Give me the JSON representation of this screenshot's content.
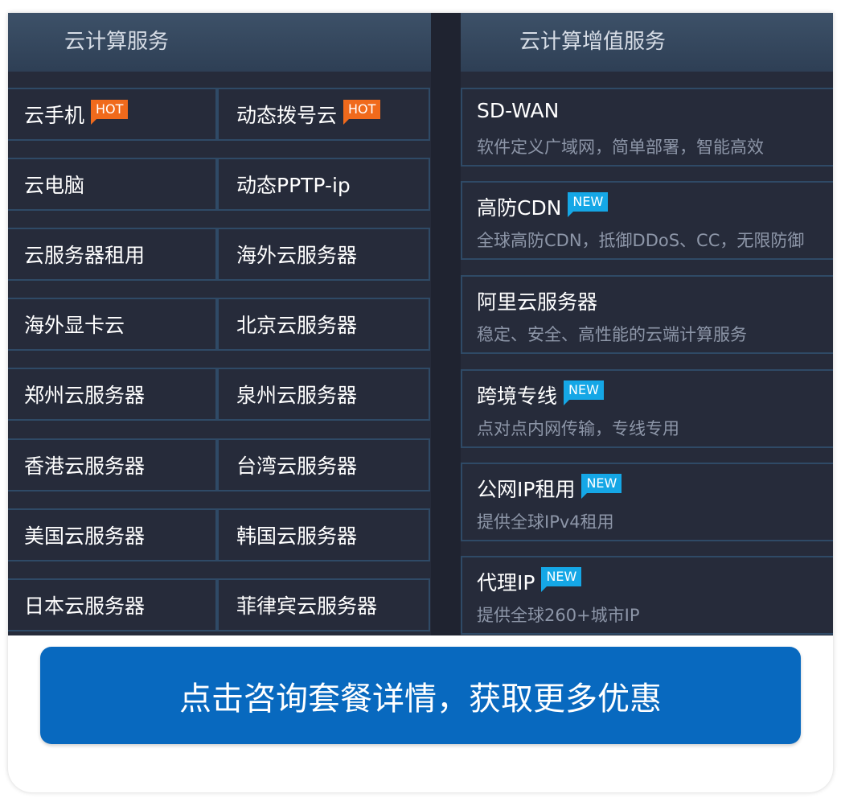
{
  "left_header": "云计算服务",
  "right_header": "云计算增值服务",
  "left_grid": [
    [
      {
        "label": "云手机",
        "tag": "HOT"
      },
      {
        "label": "动态拨号云",
        "tag": "HOT"
      }
    ],
    [
      {
        "label": "云电脑"
      },
      {
        "label": "动态PPTP-ip"
      }
    ],
    [
      {
        "label": "云服务器租用"
      },
      {
        "label": "海外云服务器"
      }
    ],
    [
      {
        "label": "海外显卡云"
      },
      {
        "label": "北京云服务器"
      }
    ],
    [
      {
        "label": "郑州云服务器"
      },
      {
        "label": "泉州云服务器"
      }
    ],
    [
      {
        "label": "香港云服务器"
      },
      {
        "label": "台湾云服务器"
      }
    ],
    [
      {
        "label": "美国云服务器"
      },
      {
        "label": "韩国云服务器"
      }
    ],
    [
      {
        "label": "日本云服务器"
      },
      {
        "label": "菲律宾云服务器"
      }
    ]
  ],
  "services": [
    {
      "name": "SD-WAN",
      "desc": "软件定义广域网，简单部署，智能高效"
    },
    {
      "name": "高防CDN",
      "tag": "NEW",
      "desc": "全球高防CDN，抵御DDoS、CC，无限防御"
    },
    {
      "name": "阿里云服务器",
      "desc": "稳定、安全、高性能的云端计算服务"
    },
    {
      "name": "跨境专线",
      "tag": "NEW",
      "desc": "点对点内网传输，专线专用"
    },
    {
      "name": "公网IP租用",
      "tag": "NEW",
      "desc": "提供全球IPv4租用"
    },
    {
      "name": "代理IP",
      "tag": "NEW",
      "desc": "提供全球260+城市IP"
    }
  ],
  "cta_label": "点击咨询套餐详情，获取更多优惠",
  "colors": {
    "panel": "#262b3a",
    "header": "#34475d",
    "hot": "#f06a1c",
    "new": "#15a7e6",
    "cta": "#0869bf"
  }
}
